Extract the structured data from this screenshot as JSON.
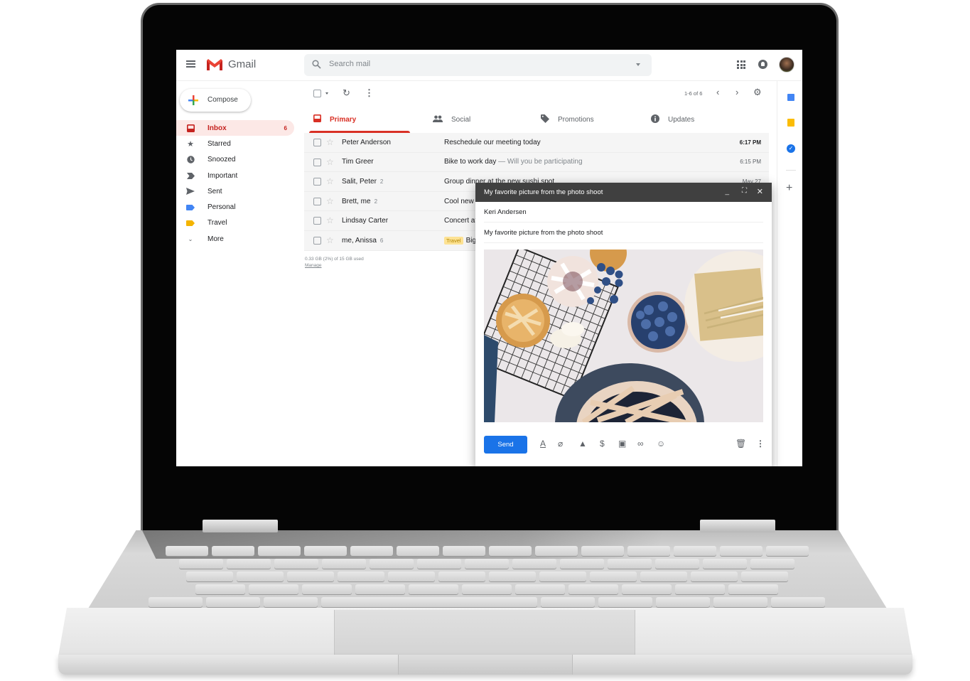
{
  "app": {
    "name": "Gmail"
  },
  "header": {
    "search_placeholder": "Search mail"
  },
  "sidebar": {
    "compose_label": "Compose",
    "items": [
      {
        "label": "Inbox",
        "icon": "inbox-icon",
        "count": "6",
        "active": true
      },
      {
        "label": "Starred",
        "icon": "star-icon"
      },
      {
        "label": "Snoozed",
        "icon": "clock-icon"
      },
      {
        "label": "Important",
        "icon": "important-icon"
      },
      {
        "label": "Sent",
        "icon": "send-icon"
      },
      {
        "label": "Personal",
        "icon": "label-icon",
        "color": "#4285f4"
      },
      {
        "label": "Travel",
        "icon": "label-icon",
        "color": "#f4b400"
      },
      {
        "label": "More",
        "icon": "chevron-down-icon"
      }
    ]
  },
  "toolbar": {
    "pager": "1-6 of 6"
  },
  "tabs": [
    {
      "label": "Primary",
      "icon": "inbox-icon",
      "active": true
    },
    {
      "label": "Social",
      "icon": "people-icon"
    },
    {
      "label": "Promotions",
      "icon": "tag-icon"
    },
    {
      "label": "Updates",
      "icon": "info-icon"
    }
  ],
  "emails": [
    {
      "sender": "Peter Anderson",
      "count": "",
      "subject": "Reschedule our meeting today",
      "snippet": "",
      "label": "",
      "time": "6:17 PM",
      "unread": true
    },
    {
      "sender": "Tim Greer",
      "count": "",
      "subject": "Bike to work day",
      "snippet": " — Will you be participating",
      "label": "",
      "time": "6:15 PM",
      "unread": false
    },
    {
      "sender": "Salit, Peter",
      "count": "2",
      "subject": "Group dinner at the new sushi spot",
      "snippet": "",
      "label": "",
      "time": "May 27",
      "unread": false
    },
    {
      "sender": "Brett, me",
      "count": "2",
      "subject": "Cool new",
      "snippet": "",
      "label": "",
      "time": "",
      "unread": false
    },
    {
      "sender": "Lindsay Carter",
      "count": "",
      "subject": "Concert at",
      "snippet": "",
      "label": "",
      "time": "",
      "unread": false
    },
    {
      "sender": "me, Anissa",
      "count": "6",
      "subject": "Big",
      "snippet": "",
      "label": "Travel",
      "time": "",
      "unread": false
    }
  ],
  "storage": {
    "usage": "0.33 GB (2%) of 15 GB used",
    "manage": "Manage"
  },
  "compose_window": {
    "title": "My favorite picture from the photo shoot",
    "to": "Keri Andersen",
    "subject": "My favorite picture from the photo shoot",
    "send_label": "Send",
    "image_alt": "Overhead photo of pies, blueberries and forks"
  },
  "colors": {
    "accent_red": "#d93025",
    "send_blue": "#1a73e8",
    "travel_label": "#fde293"
  }
}
